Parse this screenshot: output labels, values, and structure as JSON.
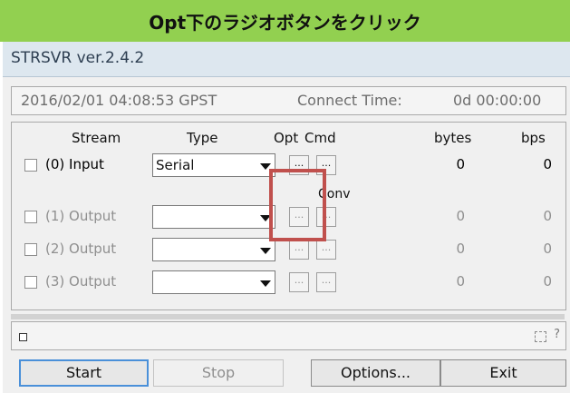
{
  "banner": {
    "text": "Opt下のラジオボタンをクリック"
  },
  "window": {
    "title": "STRSVR ver.2.4.2"
  },
  "status": {
    "datetime": "2016/02/01 04:08:53 GPST",
    "connect_label": "Connect Time:",
    "connect_value": "0d 00:00:00"
  },
  "grid": {
    "headers": {
      "stream": "Stream",
      "type": "Type",
      "opt": "Opt",
      "cmd": "Cmd",
      "bytes": "bytes",
      "bps": "bps"
    },
    "conv_label": "Conv",
    "rows": [
      {
        "label": "(0) Input",
        "type": "Serial",
        "opt": "...",
        "cmd": "...",
        "bytes": "0",
        "bps": "0"
      },
      {
        "label": "(1) Output",
        "type": "",
        "opt": "...",
        "cmd": "...",
        "bytes": "0",
        "bps": "0"
      },
      {
        "label": "(2) Output",
        "type": "",
        "opt": "...",
        "cmd": "...",
        "bytes": "0",
        "bps": "0"
      },
      {
        "label": "(3) Output",
        "type": "",
        "opt": "...",
        "cmd": "...",
        "bytes": "0",
        "bps": "0"
      }
    ]
  },
  "bottom": {
    "help": "?"
  },
  "buttons": {
    "start": "Start",
    "stop": "Stop",
    "options": "Options...",
    "exit": "Exit"
  },
  "colors": {
    "banner": "#92d050",
    "highlight": "#c0504d",
    "start_border": "#4a90d9"
  },
  "icons": {
    "combo_arrow": "triangle-down",
    "resize": "resize-grip-icon"
  }
}
